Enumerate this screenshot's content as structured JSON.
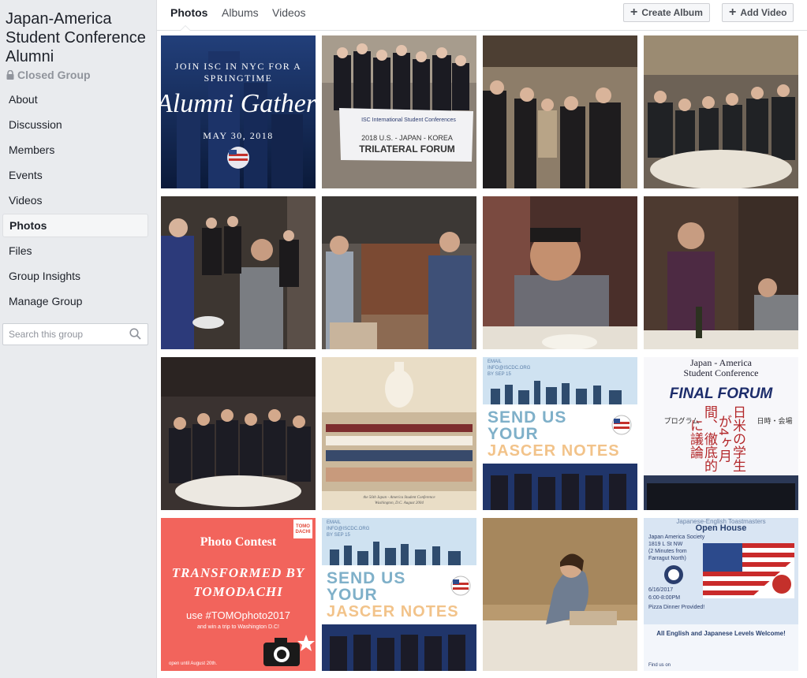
{
  "group": {
    "title": "Japan-America Student Conference Alumni",
    "privacy": "Closed Group"
  },
  "nav": [
    "About",
    "Discussion",
    "Members",
    "Events",
    "Videos",
    "Photos",
    "Files",
    "Group Insights",
    "Manage Group"
  ],
  "active_nav": "Photos",
  "search": {
    "placeholder": "Search this group"
  },
  "tabs": {
    "photos": "Photos",
    "albums": "Albums",
    "videos": "Videos"
  },
  "buttons": {
    "create_album": "Create Album",
    "add_video": "Add Video"
  },
  "photos": {
    "p1": {
      "line1": "JOIN ISC IN NYC FOR A",
      "line2": "SPRINGTIME",
      "script": "Alumni Gathering",
      "date": "MAY 30, 2018"
    },
    "p2": {
      "org": "ISC  International Student Conferences",
      "line1": "2018 U.S. - JAPAN - KOREA",
      "line2": "TRILATERAL FORUM"
    },
    "p10": {
      "caption1": "the 56th Japan - America Student Conference",
      "caption2": "Washington, D.C. August 2004"
    },
    "p11": {
      "email": "EMAIL",
      "email_addr": "INFO@ISCDC.ORG",
      "by": "BY SEP 15",
      "l1": "SEND US",
      "l2": "YOUR",
      "l3": "JASCER NOTES"
    },
    "p12": {
      "t1": "Japan - America",
      "t2": "Student Conference",
      "t3": "FINAL FORUM",
      "prog": "プログラム",
      "vertical": "日米の学生が4ヶ月間、徹底的に議論",
      "time": "日時・会場"
    },
    "p13": {
      "badge": "TOMO DACHI",
      "t1": "Photo Contest",
      "t2": "TRANSFORMED BY",
      "t3": "TOMODACHI",
      "t4": "use #TOMOphoto2017",
      "t5": "and win a trip to Washington D.C!",
      "t6": "open until August 20th."
    },
    "p14": {
      "email": "EMAIL",
      "email_addr": "INFO@ISCDC.ORG",
      "by": "BY SEP 15",
      "l1": "SEND US",
      "l2": "YOUR",
      "l3": "JASCER NOTES"
    },
    "p16": {
      "top": "Japanese-English Toastmasters",
      "title": "Open House",
      "a1": "Japan America Society",
      "a2": "1819 L St NW",
      "a3": "(2 Minutes from",
      "a4": "Farragut North)",
      "date": "6/16/2017",
      "time": "6:00-8:00PM",
      "pizza": "Pizza Dinner Provided!",
      "levels": "All English and Japanese Levels Welcome!",
      "find": "Find us on"
    }
  },
  "colors": {
    "accent": "#4267b2",
    "sidebar_bg": "#e9ebee",
    "text": "#1d2129"
  }
}
